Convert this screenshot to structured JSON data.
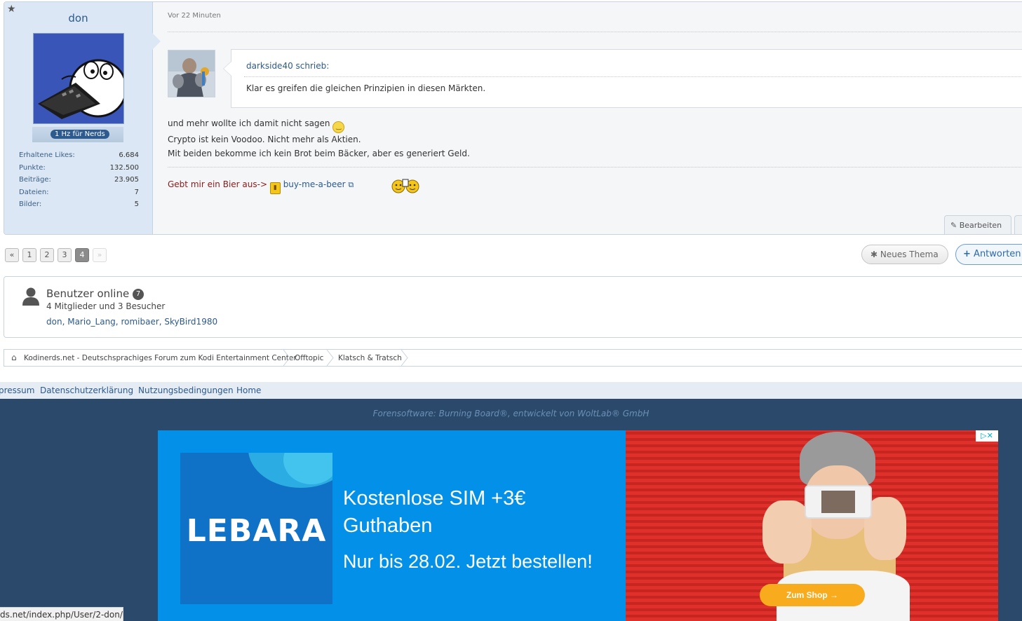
{
  "author": {
    "name": "don",
    "rank": "1 Hz für Nerds",
    "stats": [
      {
        "label": "Erhaltene Likes:",
        "value": "6.684"
      },
      {
        "label": "Punkte:",
        "value": "132.500"
      },
      {
        "label": "Beiträge:",
        "value": "23.905"
      },
      {
        "label": "Dateien:",
        "value": "7"
      },
      {
        "label": "Bilder:",
        "value": "5"
      }
    ]
  },
  "post": {
    "time": "Vor 22 Minuten",
    "quote_author": "darkside40 schrieb:",
    "quote_text": "Klar es greifen die gleichen Prinzipien in diesen Märkten.",
    "lines": [
      "und mehr wollte ich damit nicht sagen",
      "Crypto ist kein Voodoo. Nicht mehr als Aktien.",
      "Mit beiden bekomme ich kein Brot beim Bäcker, aber es generiert Geld."
    ],
    "signature_text": "Gebt mir ein Bier aus->",
    "signature_link": "buy-me-a-beer",
    "edit_label": "Bearbeiten"
  },
  "pagination": {
    "prev": "«",
    "pages": [
      "1",
      "2",
      "3",
      "4"
    ],
    "current": "4",
    "next": "»"
  },
  "actions": {
    "new_thread": "Neues Thema",
    "reply": "Antworten"
  },
  "online": {
    "title": "Benutzer online",
    "count": "7",
    "summary": "4 Mitglieder und 3 Besucher",
    "users": [
      "don",
      "Mario_Lang",
      "romibaer",
      "SkyBird1980"
    ]
  },
  "breadcrumb": [
    "Kodinerds.net - Deutschsprachiges Forum zum Kodi Entertainment Center",
    "Offtopic",
    "Klatsch & Tratsch"
  ],
  "footer": {
    "links": [
      "pressum",
      "Datenschutzerklärung",
      "Nutzungsbedingungen",
      "Home"
    ],
    "copyright": "Forensoftware: Burning Board®, entwickelt von WoltLab® GmbH"
  },
  "ad": {
    "brand": "LEBARA",
    "headline": "Kostenlose SIM +3€ Guthaben",
    "subline": "Nur bis 28.02. Jetzt bestellen!",
    "cta": "Zum Shop →",
    "choices": "▷✕"
  },
  "status_url": "ds.net/index.php/User/2-don/",
  "colors": {
    "sidebar_bg": "#dbe7f4",
    "link": "#2c5a8c",
    "footer_dark": "#2b4a6b",
    "ad_blue": "#0390e8",
    "ad_cta": "#f7ab1d"
  }
}
